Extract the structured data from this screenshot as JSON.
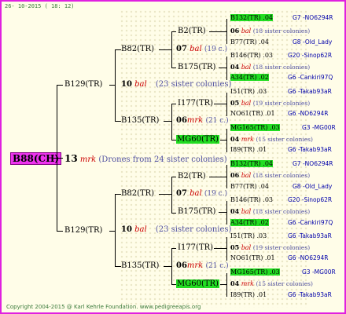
{
  "date": "26- 10-2015 ( 18: 12)",
  "copyright": "Copyright 2004-2015 @ Karl Kehrle Foundation.   www.pedigreeapis.org",
  "root": {
    "label": "B88(CH)"
  },
  "gen1": {
    "num": "13",
    "code": "mrk",
    "note": "(Drones from 24 sister colonies)"
  },
  "upper": {
    "label": "B129(TR)",
    "num": "10",
    "code": "bal",
    "note": "(23 sister colonies)",
    "a": {
      "label": "B82(TR)",
      "num": "07",
      "code": "bal",
      "note": "(19 c.)",
      "b2": {
        "label": "B2(TR)",
        "num": "06",
        "code": "bal",
        "note": "(18 sister colonies)",
        "top": {
          "label": "B132(TR) .04",
          "bee": "G7 -NO6294R"
        },
        "bot": {
          "label": "B77(TR) .04",
          "bee": "G8 -Old_Lady"
        }
      },
      "b175": {
        "label": "B175(TR)",
        "num": "04",
        "code": "bal",
        "note": "(18 sister colonies)",
        "top": {
          "label": "B146(TR) .03",
          "bee": "G20 -Sinop62R"
        },
        "bot": {
          "label": "A34(TR) .02",
          "bee": "G6 -Cankiri97Q"
        }
      }
    },
    "b": {
      "label": "B135(TR)",
      "num": "06",
      "code": "mrk",
      "note": "(21 c.)",
      "i177": {
        "label": "I177(TR)",
        "num": "05",
        "code": "bal",
        "note": "(19 sister colonies)",
        "top": {
          "label": "I51(TR) .03",
          "bee": "G6 -Takab93aR"
        },
        "bot": {
          "label": "NO61(TR) .01",
          "bee": "G6 -NO6294R"
        }
      },
      "mg60": {
        "label": "MG60(TR)",
        "num": "04",
        "code": "mrk",
        "note": "(15 sister colonies)",
        "top": {
          "label": "MG165(TR) .03",
          "bee": "G3 -MG00R"
        },
        "bot": {
          "label": "I89(TR) .01",
          "bee": "G6 -Takab93aR"
        }
      }
    }
  },
  "lower": {
    "label": "B129(TR)",
    "num": "10",
    "code": "bal",
    "note": "(23 sister colonies)",
    "a": {
      "label": "B82(TR)",
      "num": "07",
      "code": "bal",
      "note": "(19 c.)",
      "b2": {
        "label": "B2(TR)",
        "num": "06",
        "code": "bal",
        "note": "(18 sister colonies)",
        "top": {
          "label": "B132(TR) .04",
          "bee": "G7 -NO6294R"
        },
        "bot": {
          "label": "B77(TR) .04",
          "bee": "G8 -Old_Lady"
        }
      },
      "b175": {
        "label": "B175(TR)",
        "num": "04",
        "code": "bal",
        "note": "(18 sister colonies)",
        "top": {
          "label": "B146(TR) .03",
          "bee": "G20 -Sinop62R"
        },
        "bot": {
          "label": "A34(TR) .02",
          "bee": "G6 -Cankiri97Q"
        }
      }
    },
    "b": {
      "label": "B135(TR)",
      "num": "06",
      "code": "mrk",
      "note": "(21 c.)",
      "i177": {
        "label": "I177(TR)",
        "num": "05",
        "code": "bal",
        "note": "(19 sister colonies)",
        "top": {
          "label": "I51(TR) .03",
          "bee": "G6 -Takab93aR"
        },
        "bot": {
          "label": "NO61(TR) .01",
          "bee": "G6 -NO6294R"
        }
      },
      "mg60": {
        "label": "MG60(TR)",
        "num": "04",
        "code": "mrk",
        "note": "(15 sister colonies)",
        "top": {
          "label": "MG165(TR) .03",
          "bee": "G3 -MG00R"
        },
        "bot": {
          "label": "I89(TR) .01",
          "bee": "G6 -Takab93aR"
        }
      }
    }
  }
}
